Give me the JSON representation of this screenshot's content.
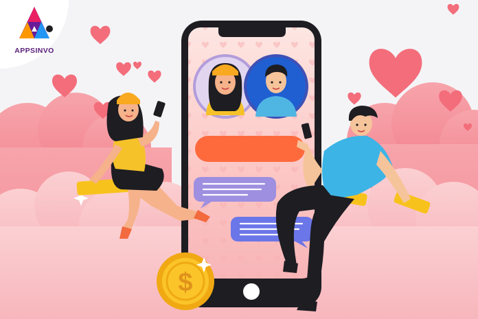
{
  "brand": {
    "name": "APPSINVO",
    "logo_colors": [
      "#6a1b9a",
      "#e91e63",
      "#ff9800",
      "#2196f3"
    ]
  },
  "scene": {
    "background_color": "#f4f4f6",
    "cloud_color": "#f59ca4",
    "heart_color": "#f26a78",
    "phone": {
      "frame_color": "#1d1d22",
      "screen_color": "#fcd4d2",
      "profiles": [
        {
          "name": "woman-avatar",
          "ring_color": "#b39ddb",
          "bg_color": "#e1d5f0"
        },
        {
          "name": "man-avatar",
          "ring_color": "#3f51b5",
          "bg_color": "#1f5fd1"
        }
      ],
      "chat_bubbles": [
        {
          "name": "orange-bar",
          "color": "#ff6a3d"
        },
        {
          "name": "purple-bubble-left",
          "color": "#9e8fe0",
          "lines": 3
        },
        {
          "name": "blue-bubble-right",
          "color": "#6b76e8",
          "lines": 3
        }
      ]
    },
    "coin": {
      "symbol": "$",
      "color": "#f8c21c"
    }
  }
}
